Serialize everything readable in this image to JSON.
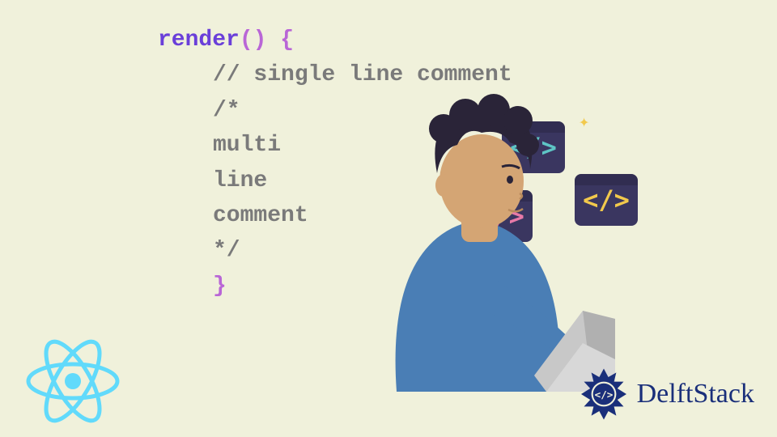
{
  "code": {
    "keyword": "render",
    "parens": "()",
    "brace_open": " {",
    "indent": "    ",
    "single_comment": "// single line comment",
    "multi_open": "/*",
    "multi_l1": "multi",
    "multi_l2": "line",
    "multi_l3": "comment",
    "multi_close": "*/",
    "brace_close": "}"
  },
  "icons": {
    "code_glyph": "</>",
    "sparkle": "✦"
  },
  "brand": {
    "name": "DelftStack"
  },
  "colors": {
    "react": "#61dafb",
    "delft_blue": "#1a2f7a",
    "icon_bg": "#3a3660",
    "teal": "#5ec5c5",
    "pink": "#e87aa8",
    "yellow": "#f2c94c"
  }
}
